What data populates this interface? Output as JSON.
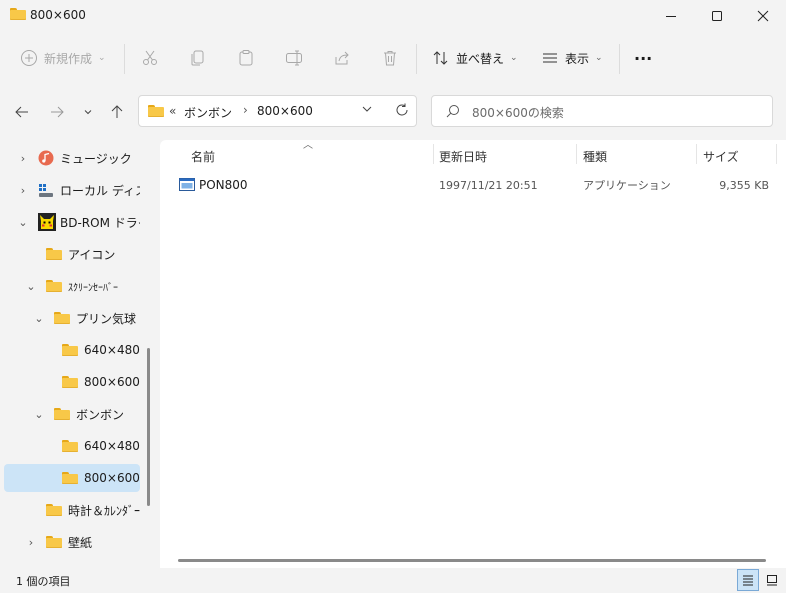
{
  "window": {
    "title": "800×600",
    "min_icon": "minimize-icon",
    "max_icon": "maximize-icon",
    "close_icon": "close-icon"
  },
  "toolbar": {
    "new_label": "新規作成",
    "sort_label": "並べ替え",
    "view_label": "表示",
    "more_label": "···"
  },
  "address": {
    "overflow": "«",
    "crumbs": [
      "ボンボン",
      "800×600"
    ],
    "separator": "›"
  },
  "search": {
    "placeholder": "800×600の検索"
  },
  "tree": [
    {
      "label": "ミュージック",
      "icon": "music-icon",
      "chevron": "›"
    },
    {
      "label": "ローカル ディスク (",
      "icon": "disk-icon",
      "chevron": "›"
    },
    {
      "label": "BD-ROM ドライブ",
      "icon": "pikachu-drive-icon",
      "chevron": "⌄"
    },
    {
      "label": "アイコン",
      "icon": "folder-icon",
      "chevron": ""
    },
    {
      "label": "ｽｸﾘｰﾝｾｰﾊﾞｰ",
      "icon": "folder-icon",
      "chevron": "⌄"
    },
    {
      "label": "プリン気球",
      "icon": "folder-icon",
      "chevron": "⌄"
    },
    {
      "label": "640×480",
      "icon": "folder-icon",
      "chevron": ""
    },
    {
      "label": "800×600",
      "icon": "folder-icon",
      "chevron": ""
    },
    {
      "label": "ボンボン",
      "icon": "folder-icon",
      "chevron": "⌄"
    },
    {
      "label": "640×480",
      "icon": "folder-icon",
      "chevron": ""
    },
    {
      "label": "800×600",
      "icon": "folder-icon",
      "chevron": "",
      "selected": true
    },
    {
      "label": "時計＆ｶﾚﾝﾀﾞｰ",
      "icon": "folder-icon",
      "chevron": ""
    },
    {
      "label": "壁紙",
      "icon": "folder-icon",
      "chevron": "›"
    }
  ],
  "columns": {
    "name": "名前",
    "modified": "更新日時",
    "type": "種類",
    "size": "サイズ"
  },
  "files": [
    {
      "name": "PON800",
      "modified": "1997/11/21 20:51",
      "type": "アプリケーション",
      "size": "9,355 KB",
      "icon": "application-icon"
    }
  ],
  "status": {
    "count_text": "1 個の項目"
  },
  "colors": {
    "accent": "#0067c0",
    "selection": "#cce4f7",
    "folder": "#f8c848"
  }
}
